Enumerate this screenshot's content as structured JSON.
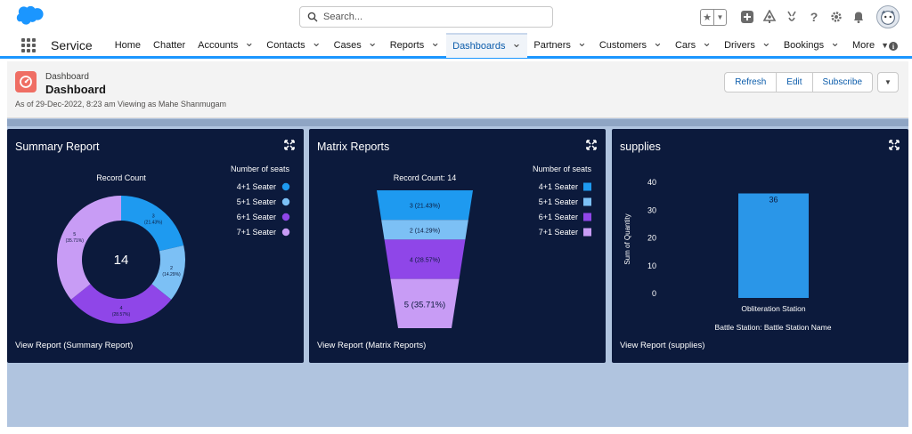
{
  "header": {
    "search_placeholder": "Search..."
  },
  "nav": {
    "app_name": "Service",
    "items": [
      {
        "label": "Home",
        "chevron": false
      },
      {
        "label": "Chatter",
        "chevron": false
      },
      {
        "label": "Accounts",
        "chevron": true
      },
      {
        "label": "Contacts",
        "chevron": true
      },
      {
        "label": "Cases",
        "chevron": true
      },
      {
        "label": "Reports",
        "chevron": true
      },
      {
        "label": "Dashboards",
        "chevron": true,
        "active": true
      },
      {
        "label": "Partners",
        "chevron": true
      },
      {
        "label": "Customers",
        "chevron": true
      },
      {
        "label": "Cars",
        "chevron": true
      },
      {
        "label": "Drivers",
        "chevron": true
      },
      {
        "label": "Bookings",
        "chevron": true
      },
      {
        "label": "More",
        "chevron": true
      }
    ]
  },
  "dashboard": {
    "kicker": "Dashboard",
    "title": "Dashboard",
    "subtitle": "As of 29-Dec-2022, 8:23 am Viewing as Mahe Shanmugam",
    "buttons": {
      "refresh": "Refresh",
      "edit": "Edit",
      "subscribe": "Subscribe"
    }
  },
  "colors": {
    "brand": "#1b96ff",
    "card_bg": "#0c1a3c",
    "seg_4": "#1e9af0",
    "seg_5": "#7cc0f5",
    "seg_6": "#8f46e8",
    "seg_7": "#c89cf5",
    "bar": "#2a96e8"
  },
  "cards": {
    "summary": {
      "title": "Summary Report",
      "footer": "View Report (Summary Report)"
    },
    "matrix": {
      "title": "Matrix Reports",
      "footer": "View Report (Matrix Reports)"
    },
    "supplies": {
      "title": "supplies",
      "footer": "View Report (supplies)"
    }
  },
  "chart_data": [
    {
      "type": "pie",
      "title": "Record Count",
      "center_label": "14",
      "legend_title": "Number of seats",
      "legend_position": "right",
      "slices": [
        {
          "name": "4+1 Seater",
          "value": 3,
          "pct_label": "(21.43%)",
          "color": "#1e9af0"
        },
        {
          "name": "5+1 Seater",
          "value": 2,
          "pct_label": "(14.29%)",
          "color": "#7cc0f5"
        },
        {
          "name": "6+1 Seater",
          "value": 4,
          "pct_label": "(28.57%)",
          "color": "#8f46e8"
        },
        {
          "name": "7+1 Seater",
          "value": 5,
          "pct_label": "(35.71%)",
          "color": "#c89cf5"
        }
      ]
    },
    {
      "type": "bar",
      "subtype": "funnel",
      "title": "Record Count: 14",
      "legend_title": "Number of seats",
      "legend_position": "right",
      "stages": [
        {
          "name": "4+1 Seater",
          "value": 3,
          "label": "3 (21.43%)",
          "color": "#1e9af0"
        },
        {
          "name": "5+1 Seater",
          "value": 2,
          "label": "2 (14.29%)",
          "color": "#7cc0f5"
        },
        {
          "name": "6+1 Seater",
          "value": 4,
          "label": "4 (28.57%)",
          "color": "#8f46e8"
        },
        {
          "name": "7+1 Seater",
          "value": 5,
          "label": "5 (35.71%)",
          "color": "#c89cf5"
        }
      ]
    },
    {
      "type": "bar",
      "categories": [
        "Obliteration Station"
      ],
      "values": [
        36
      ],
      "value_labels": [
        "36"
      ],
      "xlabel": "Battle Station: Battle Station Name",
      "ylabel": "Sum of Quantity",
      "ylim": [
        0,
        40
      ],
      "yticks": [
        0,
        10,
        20,
        30,
        40
      ],
      "color": "#2a96e8"
    }
  ]
}
